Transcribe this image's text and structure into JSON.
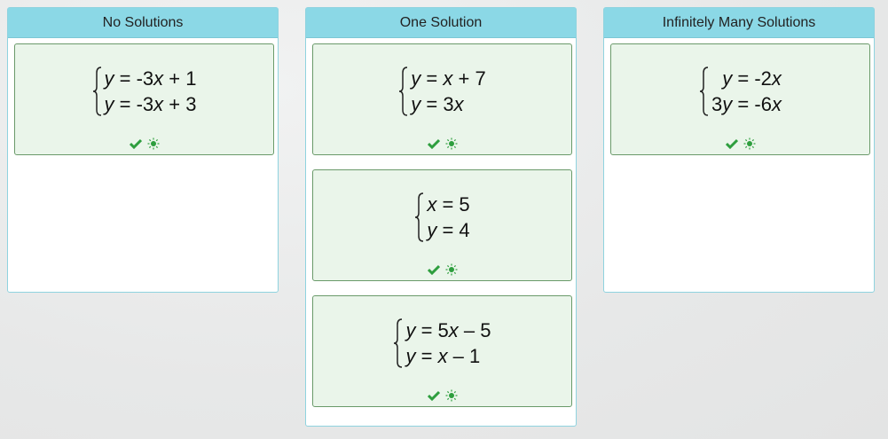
{
  "columns": [
    {
      "title": "No Solutions",
      "cards": [
        {
          "eq1": "y = -3x + 1",
          "eq2": "y = -3x + 3"
        }
      ]
    },
    {
      "title": "One Solution",
      "cards": [
        {
          "eq1": "y = x + 7",
          "eq2": "y = 3x"
        },
        {
          "eq1": "x = 5",
          "eq2": "y = 4"
        },
        {
          "eq1": "y = 5x – 5",
          "eq2": "y = x – 1"
        }
      ]
    },
    {
      "title": "Infinitely Many Solutions",
      "cards": [
        {
          "eq1": "  y = -2x",
          "eq2": "3y = -6x"
        }
      ]
    }
  ],
  "icons": {
    "correct": "check-icon",
    "hint": "lightbulb-icon"
  },
  "colors": {
    "header": "#8bd8e6",
    "card_bg": "#eaf5ea",
    "card_border": "#6a9a6a",
    "check": "#2e9e3e"
  }
}
